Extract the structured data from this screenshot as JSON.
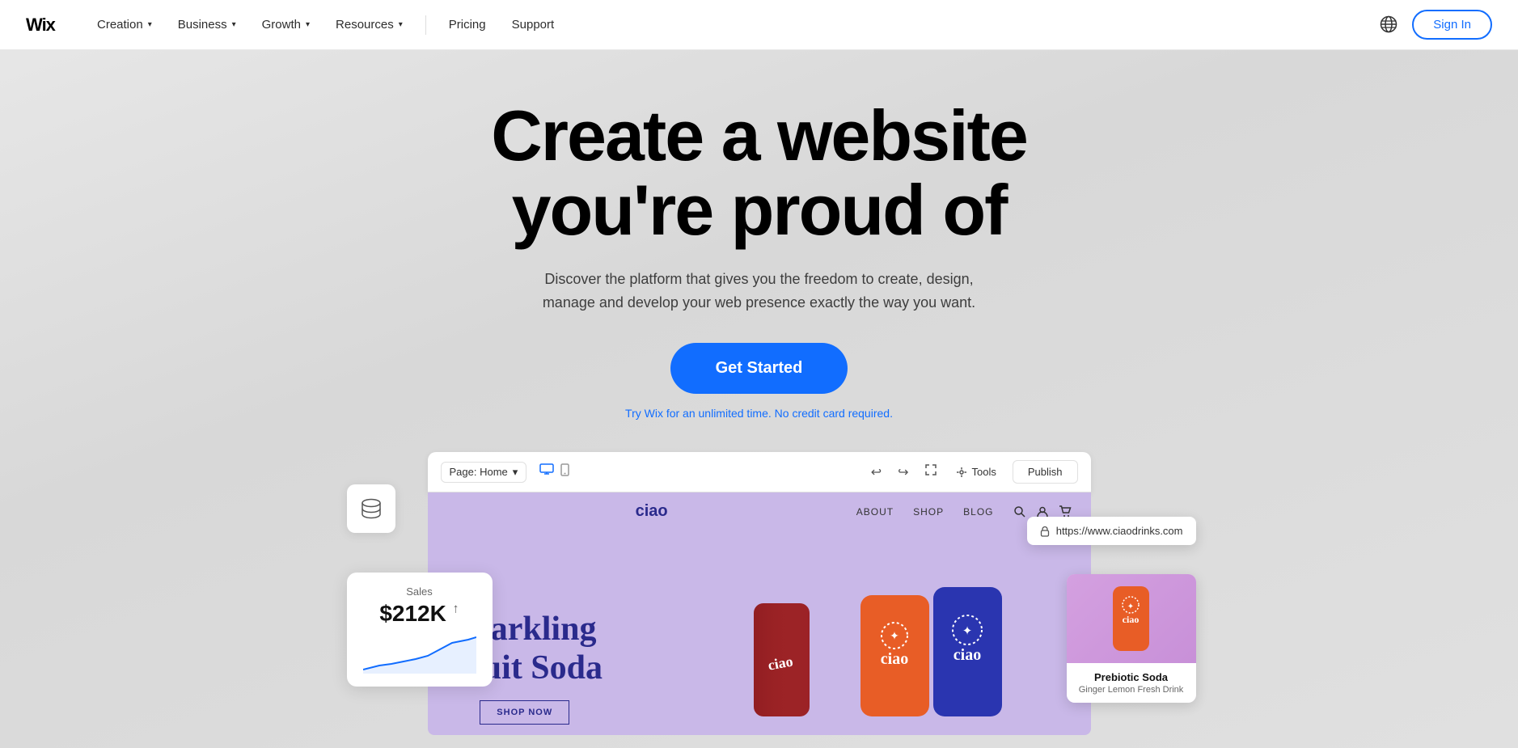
{
  "navbar": {
    "logo": "Wix",
    "nav_items": [
      {
        "label": "Creation",
        "has_dropdown": true
      },
      {
        "label": "Business",
        "has_dropdown": true
      },
      {
        "label": "Growth",
        "has_dropdown": true
      },
      {
        "label": "Resources",
        "has_dropdown": true
      },
      {
        "label": "Pricing",
        "has_dropdown": false
      },
      {
        "label": "Support",
        "has_dropdown": false
      }
    ],
    "sign_in_label": "Sign In"
  },
  "hero": {
    "title_line1": "Create a website",
    "title_line2": "you're proud of",
    "subtitle": "Discover the platform that gives you the freedom to create, design, manage and develop your web presence exactly the way you want.",
    "cta_label": "Get Started",
    "trial_text": "Try Wix for an unlimited time. No credit card required."
  },
  "editor": {
    "page_selector": "Page: Home",
    "tools_label": "Tools",
    "publish_label": "Publish",
    "ciao_site": {
      "logo": "ciao",
      "nav_links": [
        "ABOUT",
        "SHOP",
        "BLOG"
      ],
      "hero_title": "Sparkling\nFruit Soda",
      "shop_btn": "SHOP NOW",
      "url": "https://www.ciaodrinks.com"
    }
  },
  "sales_card": {
    "label": "Sales",
    "amount": "$212K"
  },
  "product_card": {
    "name": "Prebiotic Soda",
    "desc": "Ginger Lemon Fresh Drink"
  },
  "icons": {
    "globe": "🌐",
    "desktop": "🖥",
    "mobile": "📱",
    "undo": "↩",
    "redo": "↪",
    "expand": "⤢",
    "lock": "🔒",
    "search": "🔍",
    "user": "👤",
    "cart": "🛒",
    "database": "🗄"
  }
}
